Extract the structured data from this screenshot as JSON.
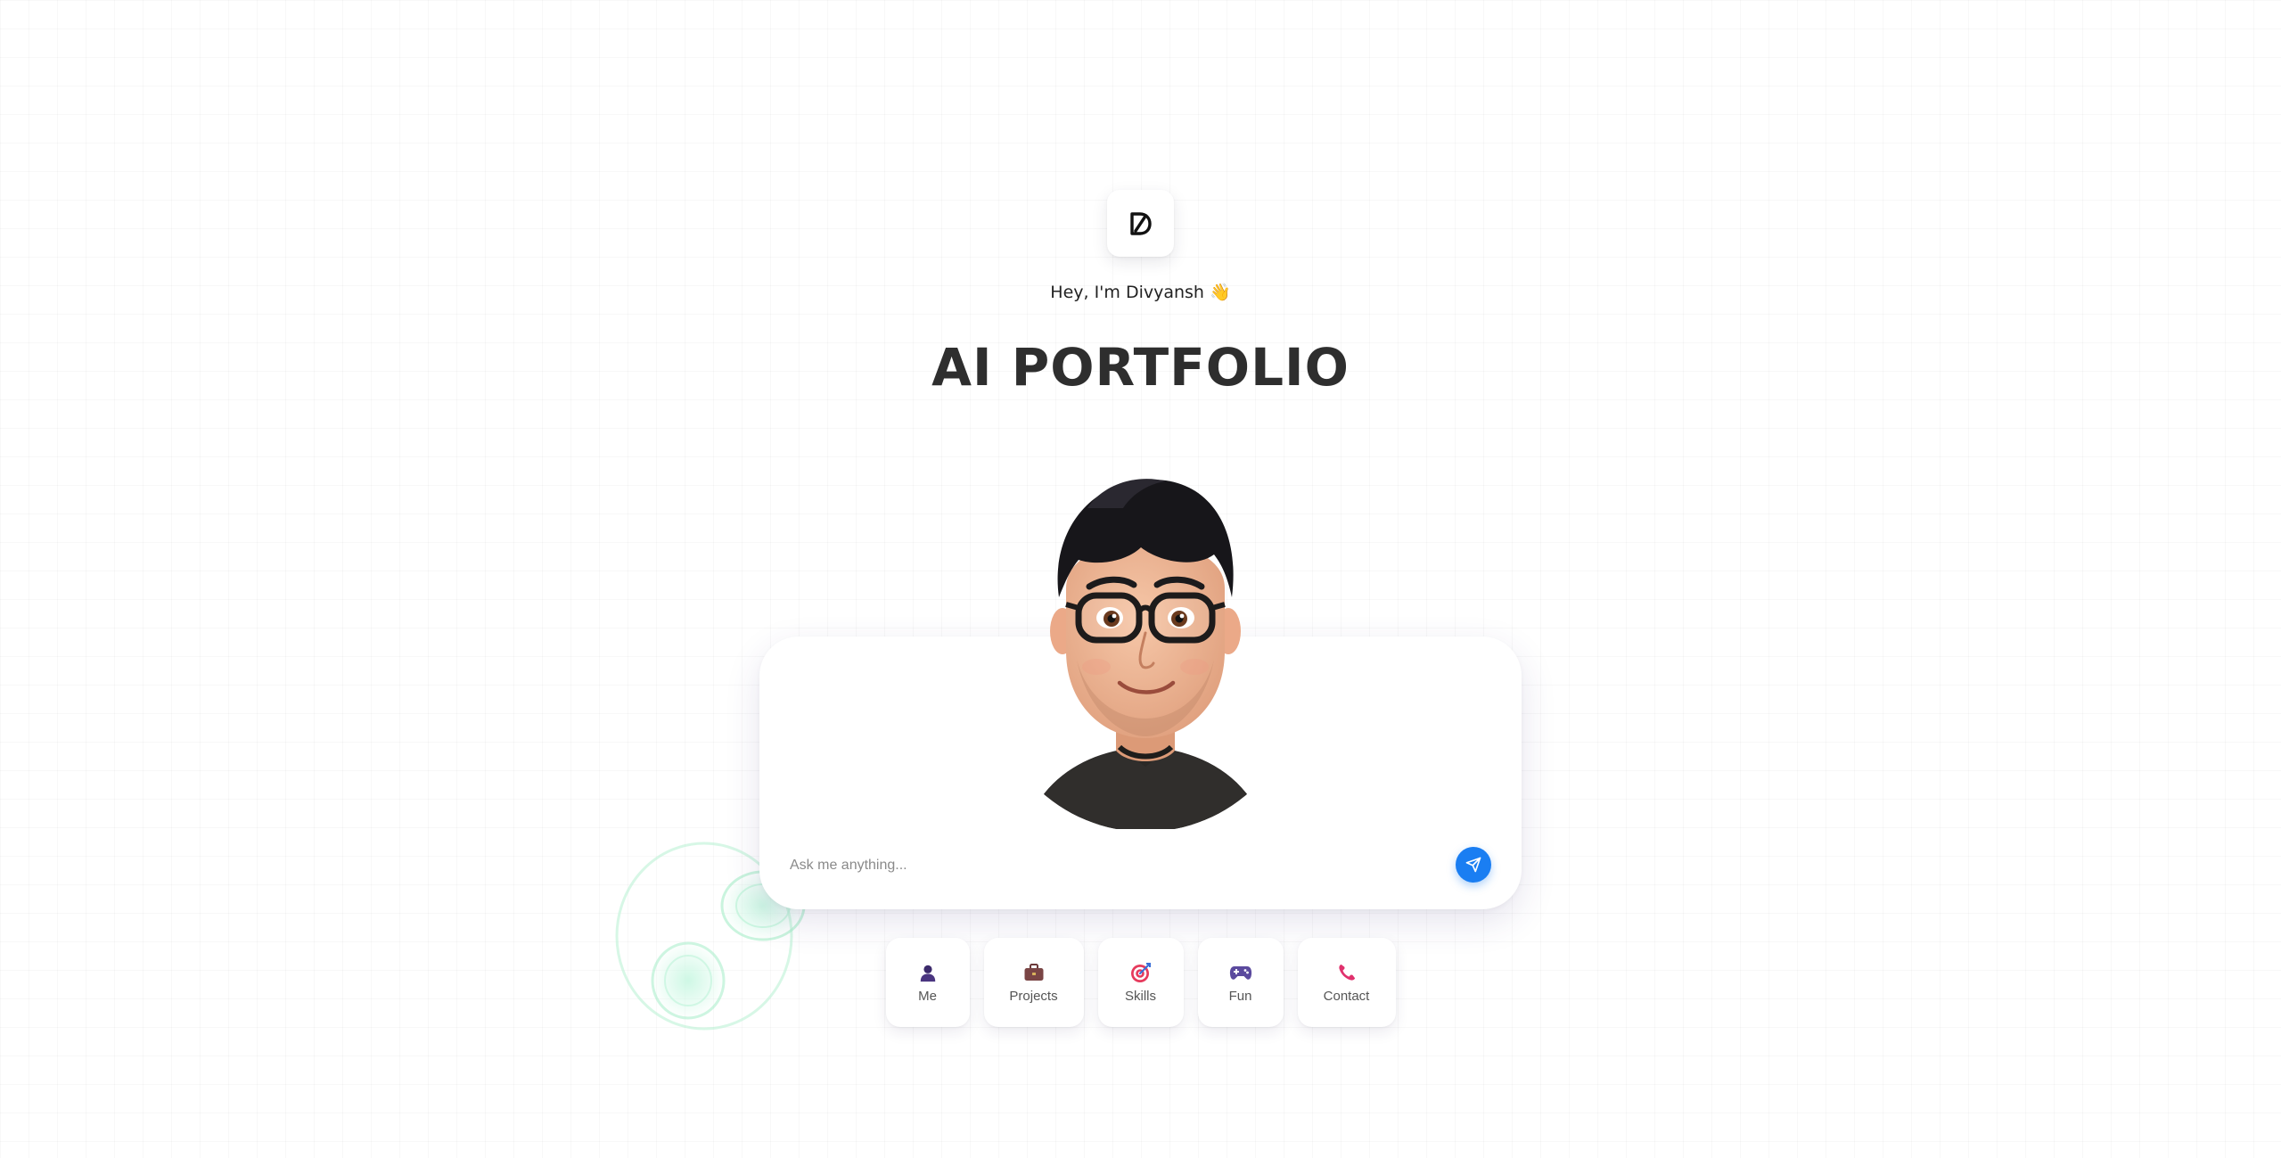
{
  "header": {
    "logo_icon": "d-monogram-logo",
    "greeting": "Hey, I'm Divyansh",
    "greeting_emoji": "👋",
    "title": "AI PORTFOLIO"
  },
  "chat": {
    "placeholder": "Ask me anything...",
    "send_icon": "paper-plane-icon"
  },
  "quick_actions": [
    {
      "label": "Me",
      "icon": "person-icon"
    },
    {
      "label": "Projects",
      "icon": "briefcase-icon"
    },
    {
      "label": "Skills",
      "icon": "target-icon"
    },
    {
      "label": "Fun",
      "icon": "gamepad-icon"
    },
    {
      "label": "Contact",
      "icon": "phone-icon"
    }
  ],
  "colors": {
    "accent": "#1a7ef2",
    "title": "#2e2e2e",
    "glow": "#9ef0c8"
  }
}
